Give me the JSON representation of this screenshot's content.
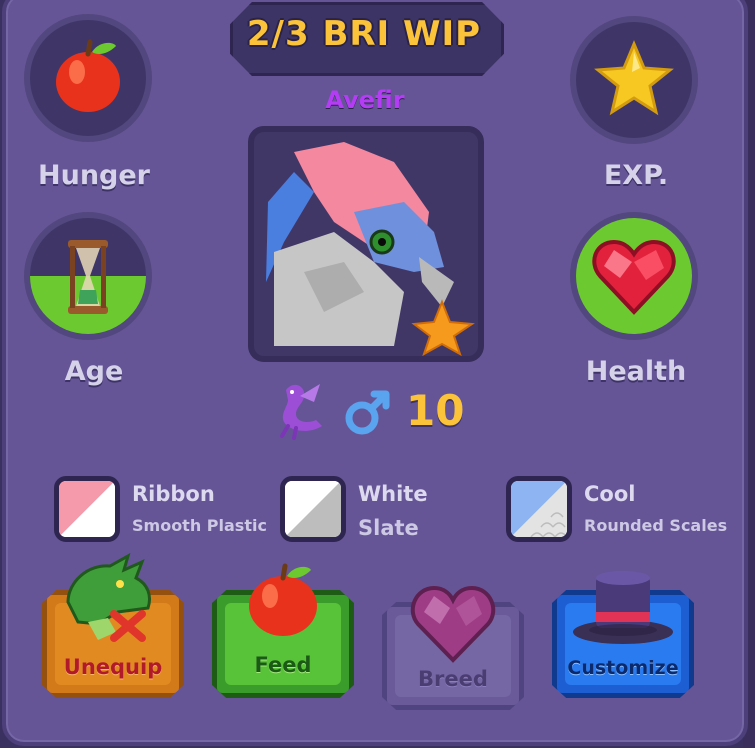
{
  "title": "2/3 BRI WIP",
  "creature_name": "Avefir",
  "stats": {
    "hunger_label": "Hunger",
    "exp_label": "EXP.",
    "age_label": "Age",
    "health_label": "Health",
    "age_fill": 0.5,
    "health_fill": 1.0
  },
  "info": {
    "species_icon": "purple-dragon-icon",
    "gender_icon": "male-symbol-icon",
    "level": "10"
  },
  "colors": [
    {
      "name": "Ribbon",
      "material": "Smooth Plastic",
      "color": "#f59aab"
    },
    {
      "name": "White",
      "material": "Slate",
      "color": "#c9c9c9"
    },
    {
      "name": "Cool",
      "material": "Rounded Scales",
      "color": "#8fb4f2"
    }
  ],
  "buttons": {
    "unequip": "Unequip",
    "feed": "Feed",
    "breed": "Breed",
    "customize": "Customize"
  },
  "accent_colors": {
    "title": "#fbc33a",
    "name": "#b53cf5",
    "green": "#6cc92f",
    "panel": "#655596"
  }
}
